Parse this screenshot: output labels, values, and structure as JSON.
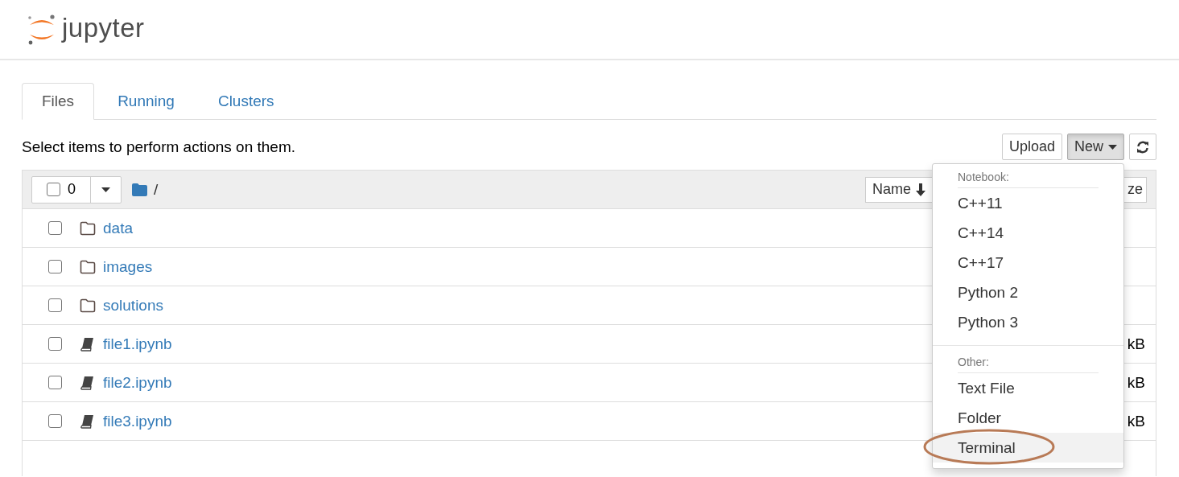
{
  "header": {
    "logo_text": "jupyter"
  },
  "tabs": [
    {
      "label": "Files",
      "selected": true
    },
    {
      "label": "Running",
      "selected": false
    },
    {
      "label": "Clusters",
      "selected": false
    }
  ],
  "toolbar": {
    "hint": "Select items to perform actions on them.",
    "buttons": [
      {
        "kind": "text",
        "label": "Upload",
        "pressed": false
      },
      {
        "kind": "dropdown",
        "label": "New",
        "pressed": true
      },
      {
        "kind": "refresh",
        "pressed": false
      }
    ]
  },
  "list_header": {
    "select_all_checked": false,
    "selected_count": "0",
    "path": "/",
    "sort_buttons": [
      {
        "label": "Name",
        "sorted": true
      },
      {
        "label": "ze",
        "sorted": false
      }
    ]
  },
  "files": [
    {
      "kind": "folder",
      "name": "data",
      "checked": false
    },
    {
      "kind": "folder",
      "name": "images",
      "checked": false
    },
    {
      "kind": "folder",
      "name": "solutions",
      "checked": false
    },
    {
      "kind": "notebook",
      "name": "file1.ipynb",
      "checked": false,
      "size": "kB"
    },
    {
      "kind": "notebook",
      "name": "file2.ipynb",
      "checked": false,
      "size": "kB"
    },
    {
      "kind": "notebook",
      "name": "file3.ipynb",
      "checked": false,
      "size": "kB"
    }
  ],
  "new_menu": {
    "open": true,
    "sections": [
      {
        "heading": "Notebook:",
        "items": [
          {
            "label": "C++11",
            "highlighted": false,
            "circled": false
          },
          {
            "label": "C++14",
            "highlighted": false,
            "circled": false
          },
          {
            "label": "C++17",
            "highlighted": false,
            "circled": false
          },
          {
            "label": "Python 2",
            "highlighted": false,
            "circled": false
          },
          {
            "label": "Python 3",
            "highlighted": false,
            "circled": false
          }
        ]
      },
      {
        "heading": "Other:",
        "items": [
          {
            "label": "Text File",
            "highlighted": false,
            "circled": false
          },
          {
            "label": "Folder",
            "highlighted": false,
            "circled": false
          },
          {
            "label": "Terminal",
            "highlighted": true,
            "circled": true
          }
        ]
      }
    ]
  }
}
